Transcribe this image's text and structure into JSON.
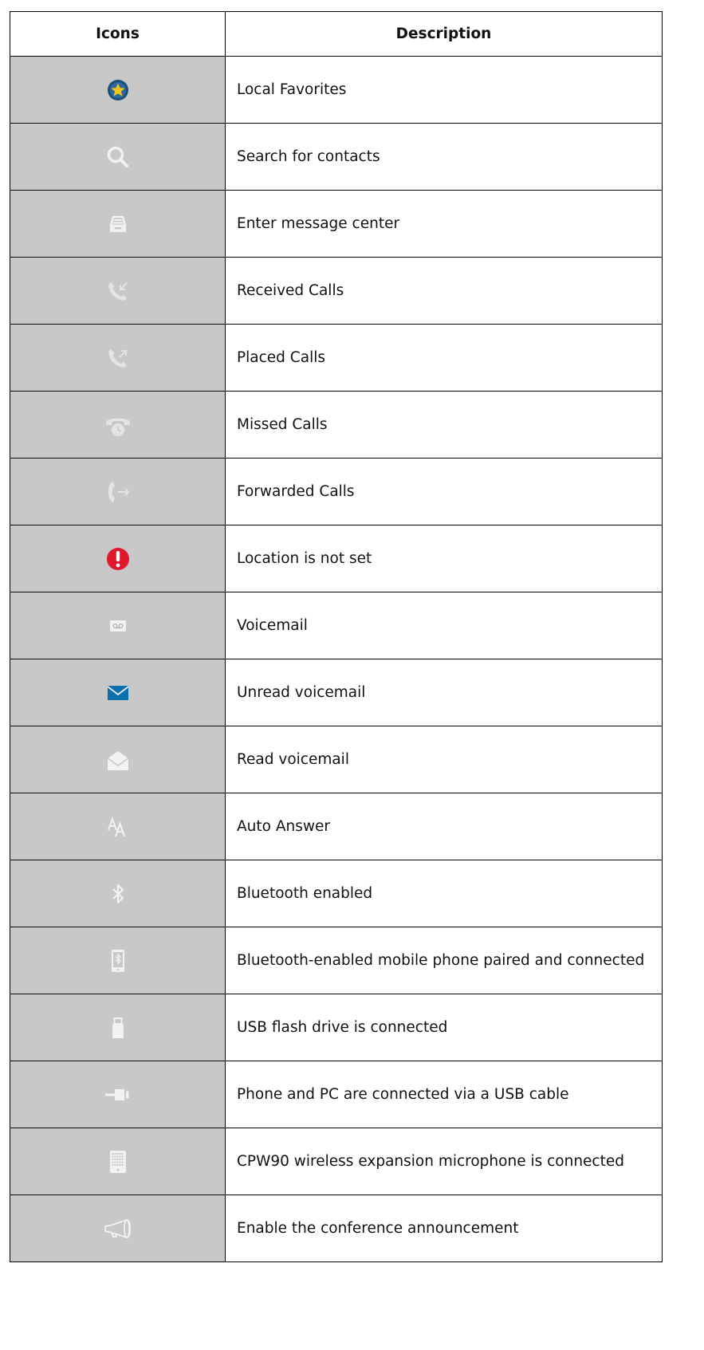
{
  "table": {
    "header": {
      "icons": "Icons",
      "description": "Description"
    },
    "rows": [
      {
        "icon": "star-favorite-icon",
        "description": "Local Favorites"
      },
      {
        "icon": "search-icon",
        "description": "Search for contacts"
      },
      {
        "icon": "inbox-tray-icon",
        "description": "Enter message center"
      },
      {
        "icon": "received-call-icon",
        "description": "Received Calls"
      },
      {
        "icon": "placed-call-icon",
        "description": "Placed Calls"
      },
      {
        "icon": "missed-call-icon",
        "description": "Missed Calls"
      },
      {
        "icon": "forwarded-call-icon",
        "description": "Forwarded Calls"
      },
      {
        "icon": "alert-exclamation-icon",
        "description": "Location is not set"
      },
      {
        "icon": "voicemail-icon",
        "description": "Voicemail"
      },
      {
        "icon": "unread-envelope-icon",
        "description": "Unread voicemail"
      },
      {
        "icon": "read-envelope-icon",
        "description": "Read voicemail"
      },
      {
        "icon": "auto-answer-icon",
        "description": "Auto Answer"
      },
      {
        "icon": "bluetooth-icon",
        "description": "Bluetooth enabled"
      },
      {
        "icon": "bluetooth-mobile-icon",
        "description": "Bluetooth-enabled mobile phone paired and connected"
      },
      {
        "icon": "usb-flash-drive-icon",
        "description": "USB flash drive is connected"
      },
      {
        "icon": "usb-cable-icon",
        "description": "Phone and PC are connected via a USB cable"
      },
      {
        "icon": "wireless-microphone-icon",
        "description": "CPW90 wireless expansion microphone is connected"
      },
      {
        "icon": "megaphone-icon",
        "description": "Enable the conference announcement"
      }
    ]
  },
  "colors": {
    "icon_cell_bg": "#c8c8c8",
    "icon_light": "#f2f2f2",
    "favorite_ring": "#1f4f78",
    "favorite_star": "#f5c318",
    "alert_red": "#e1172c",
    "unread_blue": "#0c6fae"
  }
}
